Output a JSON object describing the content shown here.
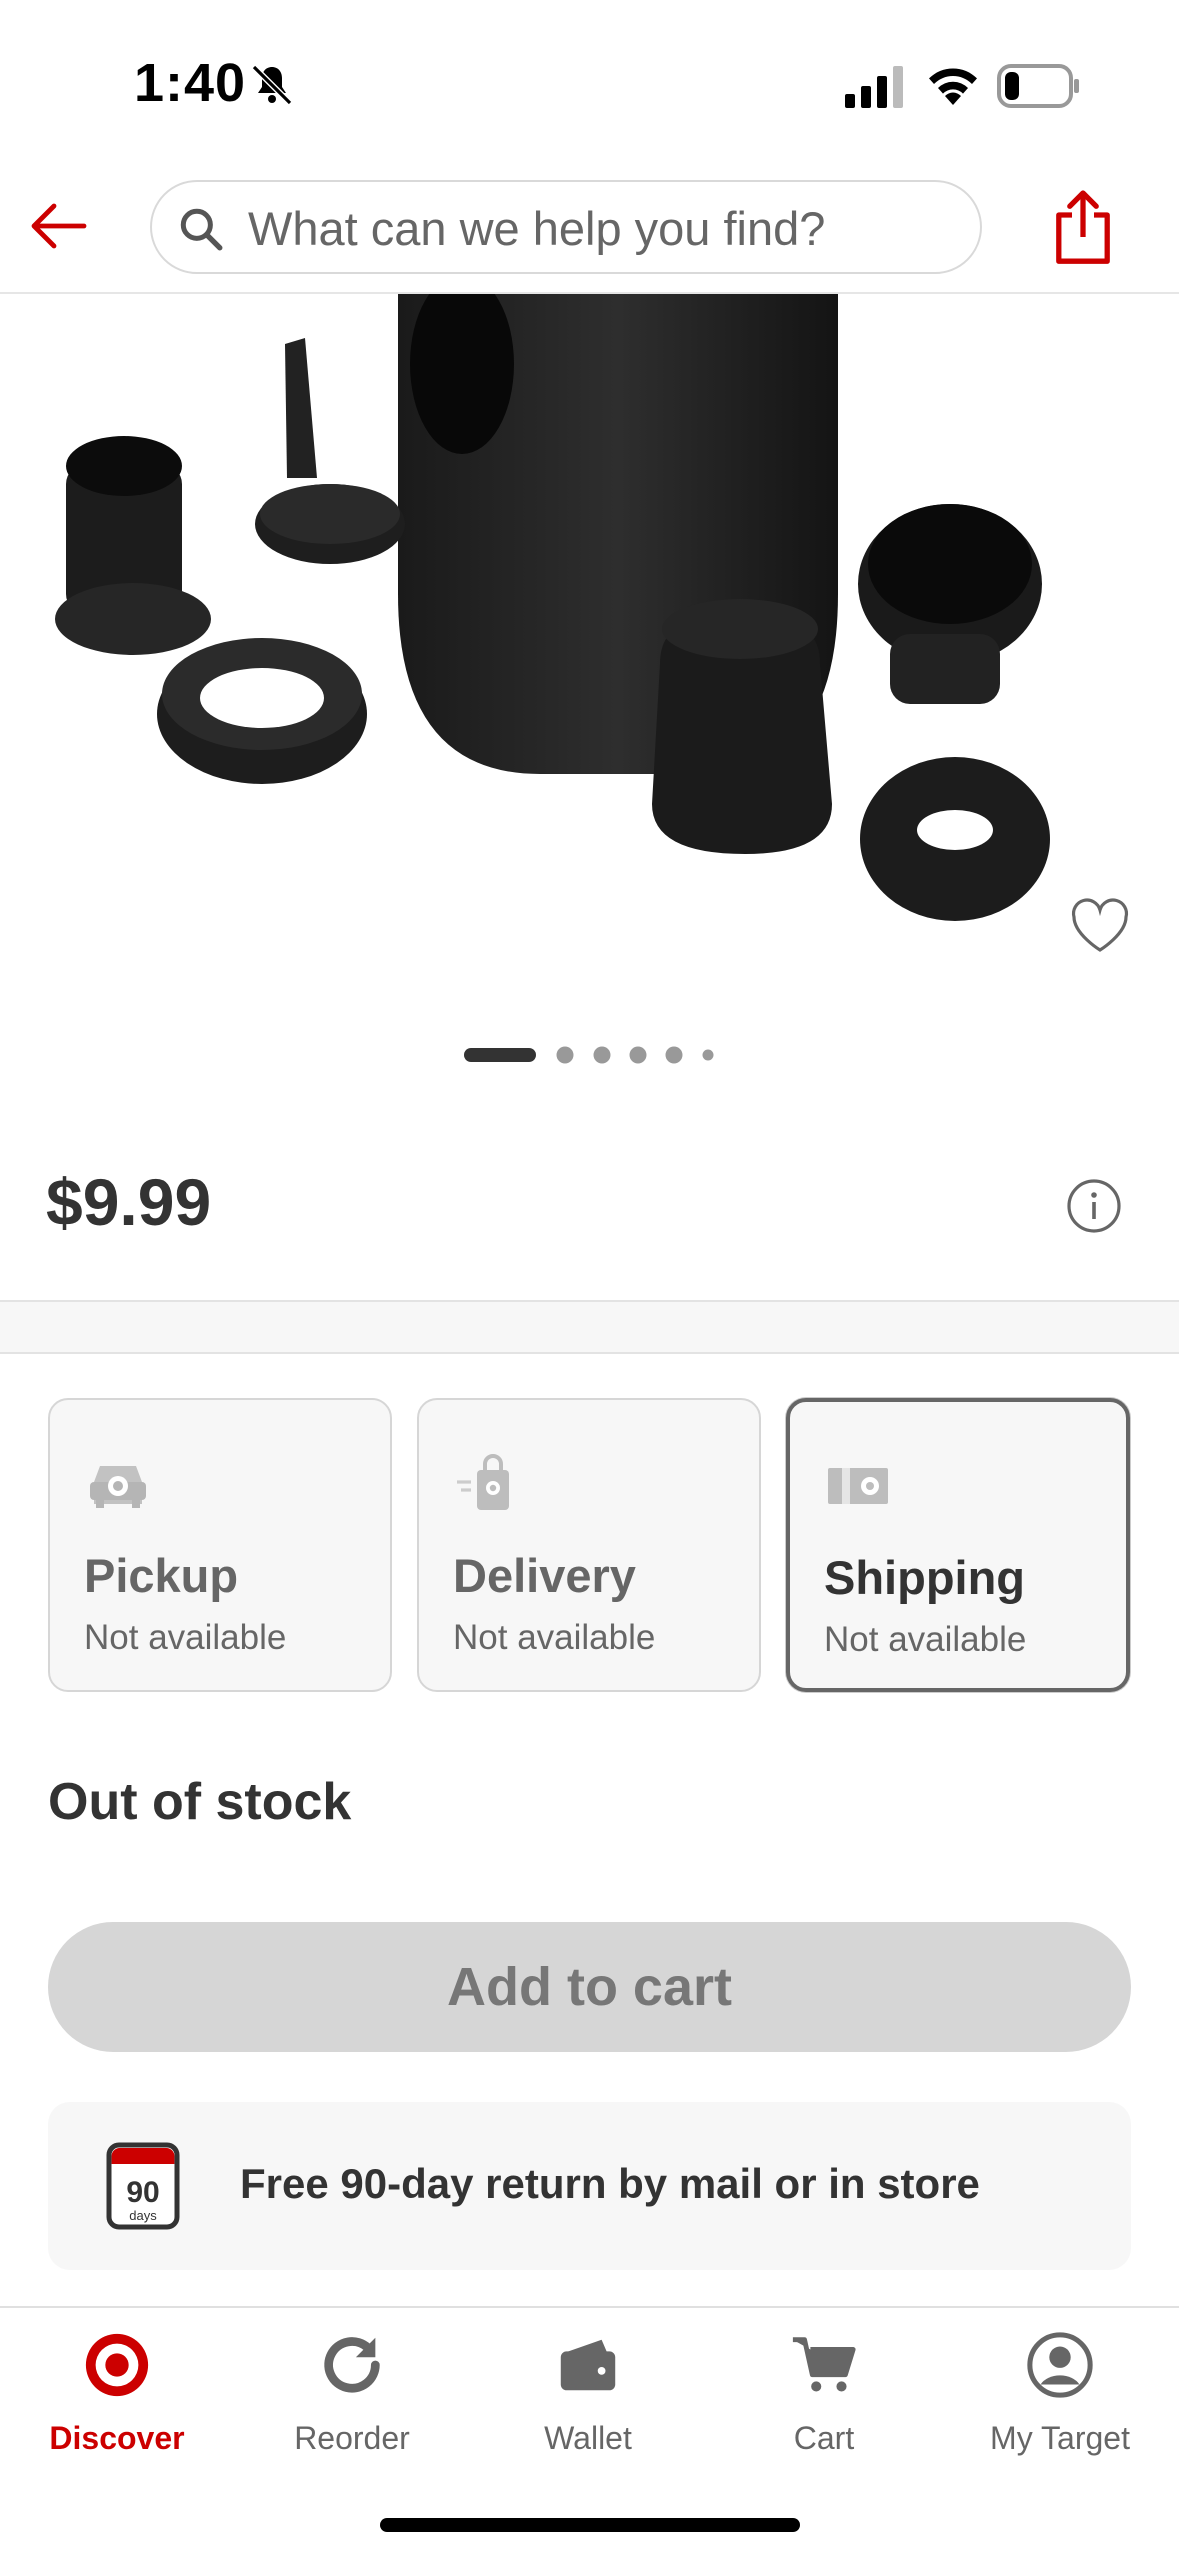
{
  "status_bar": {
    "time": "1:40"
  },
  "header": {
    "search_placeholder": "What can we help you find?"
  },
  "product": {
    "price": "$9.99",
    "carousel_total": 6,
    "carousel_active": 1
  },
  "fulfillment": [
    {
      "title": "Pickup",
      "status": "Not available",
      "icon": "pickup-car-icon"
    },
    {
      "title": "Delivery",
      "status": "Not available",
      "icon": "delivery-bag-icon"
    },
    {
      "title": "Shipping",
      "status": "Not available",
      "icon": "shipping-box-icon",
      "selected": true
    }
  ],
  "stock_status": "Out of stock",
  "add_to_cart_label": "Add to cart",
  "returns": {
    "days": "90",
    "days_unit": "days",
    "text": "Free 90-day return by mail or in store"
  },
  "nav": [
    {
      "label": "Discover",
      "icon": "target-bullseye-icon",
      "active": true
    },
    {
      "label": "Reorder",
      "icon": "reorder-refresh-icon"
    },
    {
      "label": "Wallet",
      "icon": "wallet-icon"
    },
    {
      "label": "Cart",
      "icon": "cart-icon"
    },
    {
      "label": "My Target",
      "icon": "account-icon"
    }
  ],
  "colors": {
    "brand_red": "#cc0000",
    "text": "#333333",
    "muted": "#666666"
  }
}
